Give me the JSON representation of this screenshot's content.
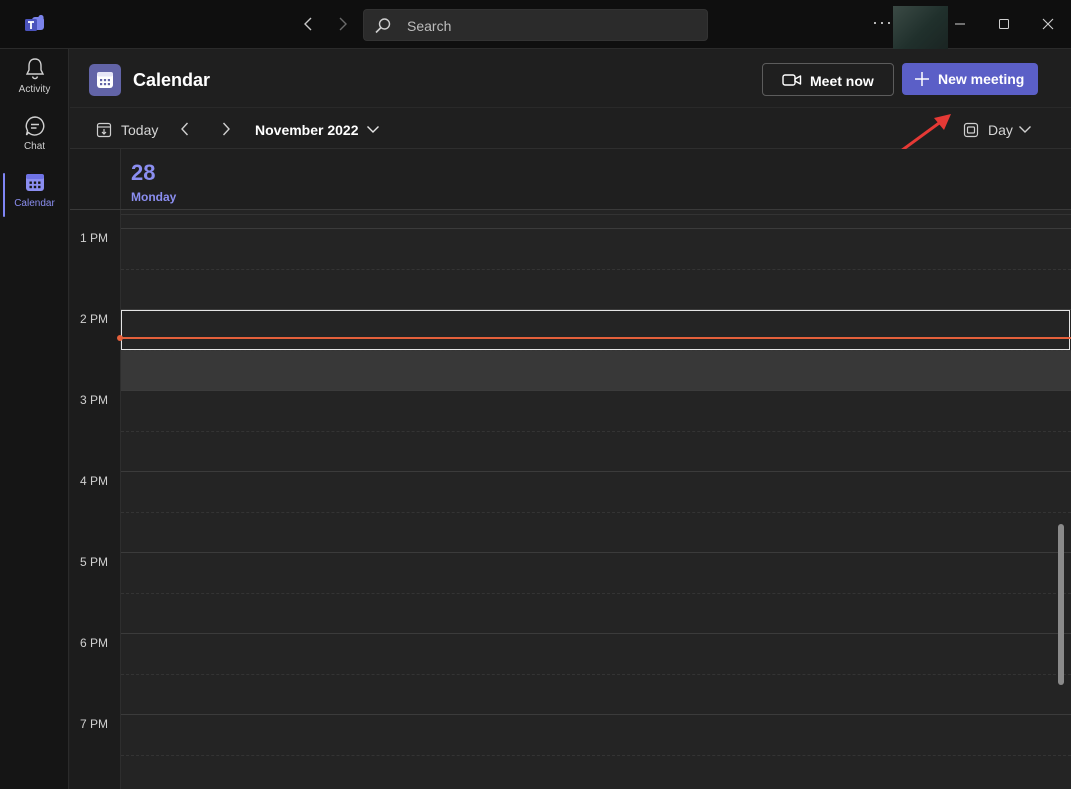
{
  "titlebar": {
    "search_placeholder": "Search",
    "more_label": "···"
  },
  "rail": {
    "items": [
      {
        "label": "Activity",
        "icon": "bell-icon"
      },
      {
        "label": "Chat",
        "icon": "chat-icon"
      },
      {
        "label": "Calendar",
        "icon": "calendar-icon",
        "active": true
      }
    ]
  },
  "header": {
    "title": "Calendar",
    "meet_now_label": "Meet now",
    "new_meeting_label": "New meeting"
  },
  "toolbar": {
    "today_label": "Today",
    "month_label": "November 2022",
    "view_label": "Day"
  },
  "day": {
    "number": "28",
    "name": "Monday"
  },
  "time_labels": [
    "1 PM",
    "2 PM",
    "3 PM",
    "4 PM",
    "5 PM",
    "6 PM",
    "7 PM"
  ],
  "colors": {
    "accent": "#8b8ef0",
    "brand": "#5b5fc7",
    "now_line": "#e5603b",
    "annotation_arrow": "#e53935"
  }
}
